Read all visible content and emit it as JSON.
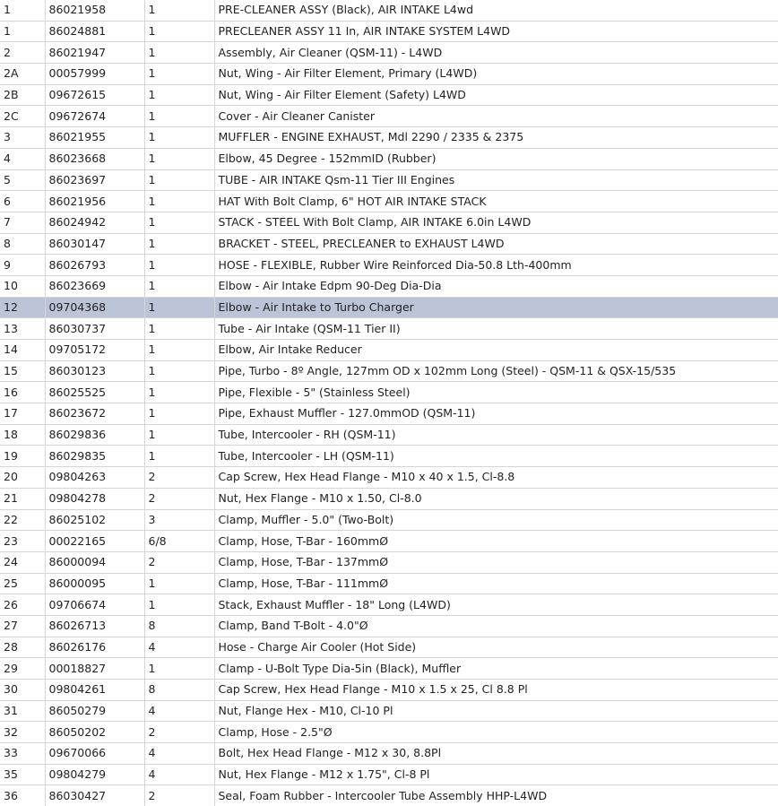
{
  "table": {
    "selected_row_index": 14,
    "rows": [
      {
        "item": "1",
        "part": "86021958",
        "qty": "1",
        "desc": "PRE-CLEANER ASSY (Black), AIR INTAKE L4wd"
      },
      {
        "item": "1",
        "part": "86024881",
        "qty": "1",
        "desc": "PRECLEANER ASSY 11 In, AIR INTAKE SYSTEM L4WD"
      },
      {
        "item": "2",
        "part": "86021947",
        "qty": "1",
        "desc": "Assembly, Air Cleaner (QSM-11) - L4WD"
      },
      {
        "item": "2A",
        "part": "00057999",
        "qty": "1",
        "desc": "Nut, Wing - Air Filter Element, Primary (L4WD)"
      },
      {
        "item": "2B",
        "part": "09672615",
        "qty": "1",
        "desc": "Nut, Wing - Air Filter Element (Safety) L4WD"
      },
      {
        "item": "2C",
        "part": "09672674",
        "qty": "1",
        "desc": "Cover - Air Cleaner Canister"
      },
      {
        "item": "3",
        "part": "86021955",
        "qty": "1",
        "desc": "MUFFLER - ENGINE EXHAUST, Mdl 2290 / 2335 & 2375"
      },
      {
        "item": "4",
        "part": "86023668",
        "qty": "1",
        "desc": "Elbow, 45 Degree - 152mmID (Rubber)"
      },
      {
        "item": "5",
        "part": "86023697",
        "qty": "1",
        "desc": "TUBE - AIR INTAKE Qsm-11 Tier III Engines"
      },
      {
        "item": "6",
        "part": "86021956",
        "qty": "1",
        "desc": "HAT With Bolt Clamp, 6\" HOT AIR INTAKE STACK"
      },
      {
        "item": "7",
        "part": "86024942",
        "qty": "1",
        "desc": "STACK - STEEL With Bolt Clamp, AIR INTAKE 6.0in L4WD"
      },
      {
        "item": "8",
        "part": "86030147",
        "qty": "1",
        "desc": "BRACKET - STEEL, PRECLEANER to EXHAUST L4WD"
      },
      {
        "item": "9",
        "part": "86026793",
        "qty": "1",
        "desc": "HOSE - FLEXIBLE, Rubber Wire Reinforced Dia-50.8 Lth-400mm"
      },
      {
        "item": "10",
        "part": "86023669",
        "qty": "1",
        "desc": "Elbow - Air Intake Edpm 90-Deg Dia-Dia"
      },
      {
        "item": "12",
        "part": "09704368",
        "qty": "1",
        "desc": "Elbow - Air Intake to Turbo Charger"
      },
      {
        "item": "13",
        "part": "86030737",
        "qty": "1",
        "desc": "Tube - Air Intake (QSM-11 Tier II)"
      },
      {
        "item": "14",
        "part": "09705172",
        "qty": "1",
        "desc": "Elbow, Air Intake Reducer"
      },
      {
        "item": "15",
        "part": "86030123",
        "qty": "1",
        "desc": "Pipe, Turbo - 8º Angle, 127mm OD x 102mm Long (Steel) - QSM-11 & QSX-15/535"
      },
      {
        "item": "16",
        "part": "86025525",
        "qty": "1",
        "desc": "Pipe, Flexible - 5\" (Stainless Steel)"
      },
      {
        "item": "17",
        "part": "86023672",
        "qty": "1",
        "desc": "Pipe, Exhaust Muffler - 127.0mmOD (QSM-11)"
      },
      {
        "item": "18",
        "part": "86029836",
        "qty": "1",
        "desc": "Tube, Intercooler - RH (QSM-11)"
      },
      {
        "item": "19",
        "part": "86029835",
        "qty": "1",
        "desc": "Tube, Intercooler - LH (QSM-11)"
      },
      {
        "item": "20",
        "part": "09804263",
        "qty": "2",
        "desc": "Cap Screw, Hex Head Flange - M10 x 40 x 1.5, Cl-8.8"
      },
      {
        "item": "21",
        "part": "09804278",
        "qty": "2",
        "desc": "Nut, Hex Flange - M10 x 1.50, Cl-8.0"
      },
      {
        "item": "22",
        "part": "86025102",
        "qty": "3",
        "desc": "Clamp, Muffler - 5.0\" (Two-Bolt)"
      },
      {
        "item": "23",
        "part": "00022165",
        "qty": "6/8",
        "desc": "Clamp, Hose, T-Bar - 160mmØ"
      },
      {
        "item": "24",
        "part": "86000094",
        "qty": "2",
        "desc": "Clamp, Hose, T-Bar - 137mmØ"
      },
      {
        "item": "25",
        "part": "86000095",
        "qty": "1",
        "desc": "Clamp, Hose, T-Bar - 111mmØ"
      },
      {
        "item": "26",
        "part": "09706674",
        "qty": "1",
        "desc": "Stack, Exhaust Muffler - 18\" Long (L4WD)"
      },
      {
        "item": "27",
        "part": "86026713",
        "qty": "8",
        "desc": "Clamp, Band T-Bolt - 4.0\"Ø"
      },
      {
        "item": "28",
        "part": "86026176",
        "qty": "4",
        "desc": "Hose - Charge Air Cooler (Hot Side)"
      },
      {
        "item": "29",
        "part": "00018827",
        "qty": "1",
        "desc": "Clamp - U-Bolt Type Dia-5in (Black), Muffler"
      },
      {
        "item": "30",
        "part": "09804261",
        "qty": "8",
        "desc": "Cap Screw, Hex Head Flange - M10 x 1.5 x 25, Cl 8.8 Pl"
      },
      {
        "item": "31",
        "part": "86050279",
        "qty": "4",
        "desc": "Nut, Flange Hex - M10, Cl-10 Pl"
      },
      {
        "item": "32",
        "part": "86050202",
        "qty": "2",
        "desc": "Clamp, Hose - 2.5\"Ø"
      },
      {
        "item": "33",
        "part": "09670066",
        "qty": "4",
        "desc": "Bolt, Hex Head Flange - M12 x 30, 8.8Pl"
      },
      {
        "item": "35",
        "part": "09804279",
        "qty": "4",
        "desc": "Nut, Hex Flange - M12 x 1.75\", Cl-8 Pl"
      },
      {
        "item": "36",
        "part": "86030427",
        "qty": "2",
        "desc": "Seal, Foam Rubber - Intercooler Tube Assembly HHP-L4WD"
      }
    ]
  }
}
